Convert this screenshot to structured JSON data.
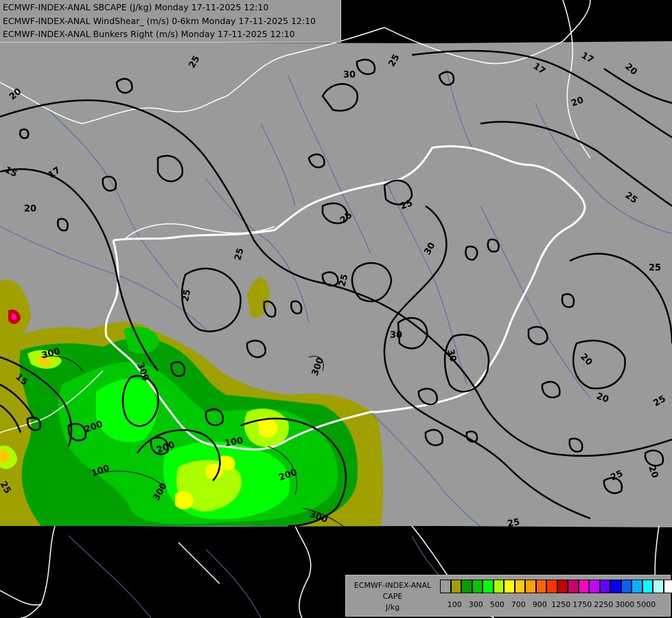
{
  "titles": [
    "ECMWF-INDEX-ANAL SBCAPE (J/kg) Monday 17-11-2025 12:10",
    "ECMWF-INDEX-ANAL WindShear_ (m/s) 0-6km Monday 17-11-2025 12:10",
    "ECMWF-INDEX-ANAL Bunkers Right (m/s) Monday 17-11-2025 12:10"
  ],
  "legend": {
    "line1": "ECMWF-INDEX-ANAL",
    "line2": "CAPE",
    "line3": "J/kg",
    "colors": [
      "#9a9a9a",
      "#a0a000",
      "#00a000",
      "#00c800",
      "#00ff00",
      "#aaff00",
      "#ffff00",
      "#ffcc00",
      "#ffa000",
      "#ff6400",
      "#ff3200",
      "#c80000",
      "#c8006e",
      "#ff00c8",
      "#c800ff",
      "#6400ff",
      "#0000ff",
      "#0064ff",
      "#00b4ff",
      "#00ffff",
      "#aaffff",
      "#ffffff"
    ],
    "ticks": [
      "100",
      "300",
      "500",
      "700",
      "900",
      "1250",
      "1750",
      "2250",
      "3000",
      "5000"
    ]
  },
  "map_labels": {
    "shear": [
      "25",
      "30",
      "20",
      "17",
      "15",
      "20",
      "25",
      "25",
      "25",
      "30",
      "25",
      "30",
      "25",
      "30",
      "20",
      "20",
      "25",
      "25",
      "25",
      "25",
      "20",
      "25",
      "17",
      "20",
      "17",
      "25",
      "20",
      "15",
      "25"
    ],
    "cape": [
      "300",
      "300",
      "200",
      "100",
      "300",
      "200",
      "200",
      "300",
      "100",
      "300"
    ]
  },
  "colors": {
    "background": "#9a9a9a",
    "no_data": "#000000",
    "border": "#ffffff",
    "river": "#4a6aa8",
    "contour": "#000000"
  }
}
